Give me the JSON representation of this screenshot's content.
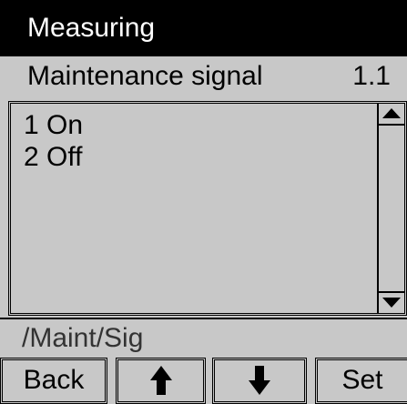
{
  "header": {
    "title": "Measuring"
  },
  "parameter": {
    "name": "Maintenance signal",
    "number": "1.1"
  },
  "list": {
    "items": [
      "1 On",
      "2 Off"
    ]
  },
  "status": {
    "path": "/Maint/Sig"
  },
  "softkeys": {
    "back_label": "Back",
    "up_icon": "arrow-up-icon",
    "down_icon": "arrow-down-icon",
    "set_label": "Set"
  },
  "colors": {
    "background": "#c8c8c8",
    "title_bar": "#000000",
    "title_text": "#ffffff"
  }
}
